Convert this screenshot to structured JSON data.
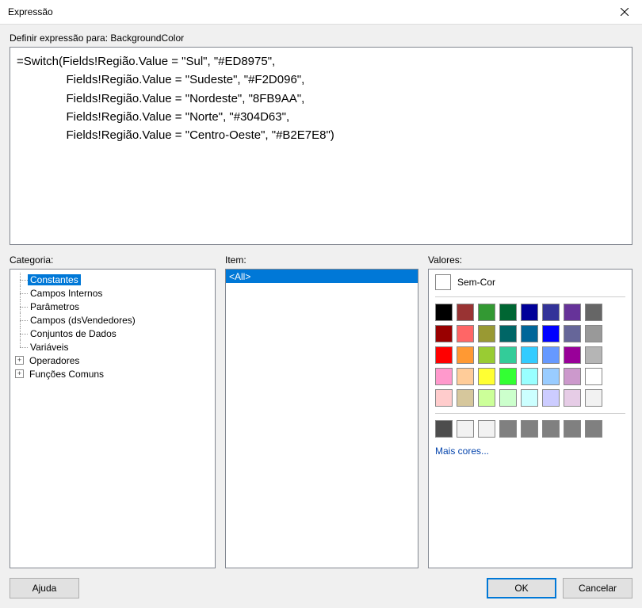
{
  "window": {
    "title": "Expressão"
  },
  "prompt": "Definir expressão para: BackgroundColor",
  "expression": "=Switch(Fields!Região.Value = \"Sul\", \"#ED8975\",\n               Fields!Região.Value = \"Sudeste\", \"#F2D096\",\n               Fields!Região.Value = \"Nordeste\", \"8FB9AA\",\n               Fields!Região.Value = \"Norte\", \"#304D63\",\n               Fields!Região.Value = \"Centro-Oeste\", \"#B2E7E8\")",
  "panels": {
    "category_label": "Categoria:",
    "item_label": "Item:",
    "values_label": "Valores:"
  },
  "categories": [
    {
      "label": "Constantes",
      "expandable": false,
      "selected": true,
      "depth": 1
    },
    {
      "label": "Campos Internos",
      "expandable": false,
      "selected": false,
      "depth": 1
    },
    {
      "label": "Parâmetros",
      "expandable": false,
      "selected": false,
      "depth": 1
    },
    {
      "label": "Campos (dsVendedores)",
      "expandable": false,
      "selected": false,
      "depth": 1
    },
    {
      "label": "Conjuntos de Dados",
      "expandable": false,
      "selected": false,
      "depth": 1
    },
    {
      "label": "Variáveis",
      "expandable": false,
      "selected": false,
      "depth": 1,
      "last": true
    },
    {
      "label": "Operadores",
      "expandable": true,
      "selected": false,
      "depth": 0
    },
    {
      "label": "Funções Comuns",
      "expandable": true,
      "selected": false,
      "depth": 0
    }
  ],
  "items": [
    {
      "label": "<All>",
      "selected": true
    }
  ],
  "values": {
    "nocolor_label": "Sem-Cor",
    "more_colors": "Mais cores...",
    "swatches_main": [
      "#000000",
      "#993333",
      "#339933",
      "#006633",
      "#000099",
      "#333399",
      "#663399",
      "#666666",
      "#990000",
      "#ff6666",
      "#999933",
      "#006666",
      "#006699",
      "#0000ff",
      "#666699",
      "#999999",
      "#ff0000",
      "#ff9933",
      "#99cc33",
      "#33cc99",
      "#33ccff",
      "#6699ff",
      "#990099",
      "#b5b5b5",
      "#ff99cc",
      "#ffcc99",
      "#ffff33",
      "#33ff33",
      "#99ffff",
      "#99ccff",
      "#cc99cc",
      "#ffffff",
      "#ffcccc",
      "#d6c79c",
      "#ccff99",
      "#ccffcc",
      "#ccffff",
      "#ccccff",
      "#e6cce6",
      "#f2f2f2"
    ],
    "swatches_recent": [
      "#4d4d4d",
      "#f2f2f2",
      "#f2f2f2",
      "#808080",
      "#808080",
      "#808080",
      "#808080",
      "#808080"
    ]
  },
  "buttons": {
    "help": "Ajuda",
    "ok": "OK",
    "cancel": "Cancelar"
  }
}
